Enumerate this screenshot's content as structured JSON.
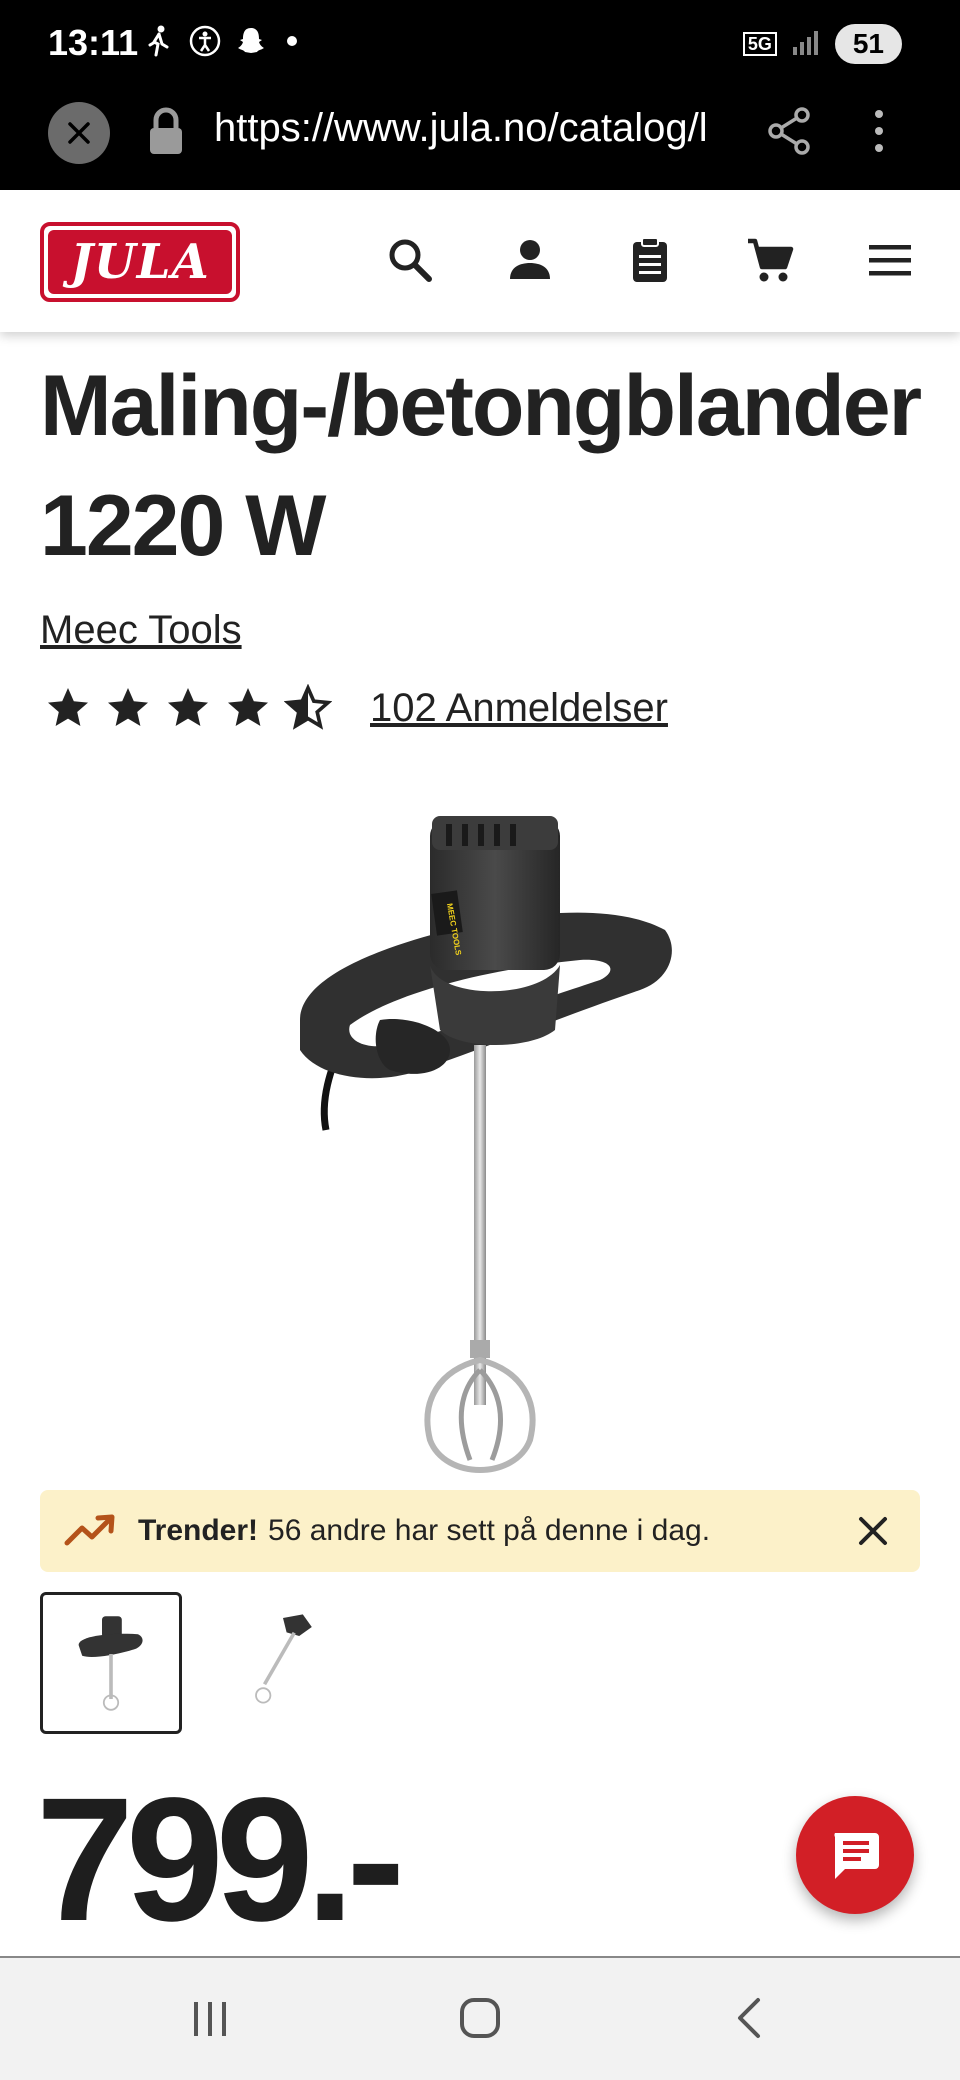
{
  "status_bar": {
    "time": "13:11",
    "left_icons": [
      "walking-icon",
      "accessibility-icon",
      "snapchat-icon",
      "dot-icon"
    ],
    "network": "5G",
    "battery": "51"
  },
  "browser": {
    "url": "https://www.jula.no/catalog/l"
  },
  "header": {
    "logo_text": "JULA",
    "icons": [
      "search-icon",
      "account-icon",
      "shopping-list-icon",
      "cart-icon",
      "menu-icon"
    ]
  },
  "product": {
    "title": "Maling-/betongblander 1220 W",
    "brand": "Meec Tools",
    "rating": 4.5,
    "reviews_label": "102 Anmeldelser",
    "image_label": "MEEC TOOLS",
    "price": "799.-"
  },
  "trend_banner": {
    "bold": "Trender!",
    "text": "56 andre har sett på denne i dag."
  },
  "thumbnails": [
    {
      "name": "thumbnail-1",
      "active": true
    },
    {
      "name": "thumbnail-2",
      "active": false
    }
  ],
  "colors": {
    "brand_red": "#c8102e",
    "chat_red": "#d21f26",
    "banner_bg": "#fcf1c9",
    "trend_arrow": "#b4531a"
  }
}
